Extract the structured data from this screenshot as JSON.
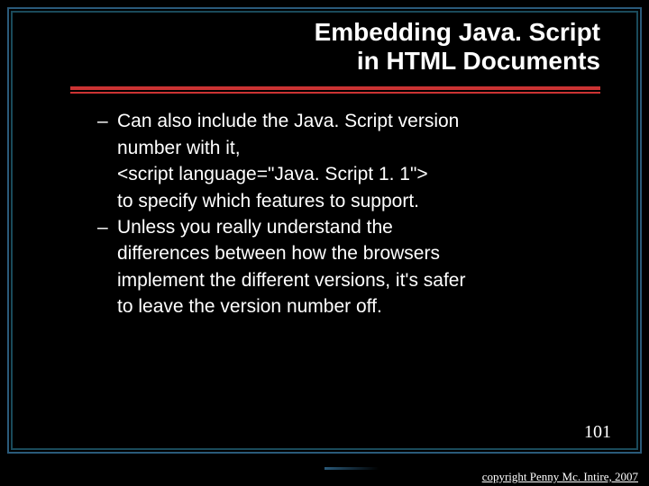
{
  "title": {
    "line1": "Embedding Java. Script",
    "line2": "in HTML Documents"
  },
  "bullets": [
    {
      "lines": [
        "Can also include the Java. Script version",
        "number with it,",
        "<script language=\"Java. Script 1. 1\">",
        "to specify which features to support."
      ]
    },
    {
      "lines": [
        "Unless you really understand the",
        "differences between how the browsers",
        "implement the different versions, it's safer",
        "to leave the version number off."
      ]
    }
  ],
  "page_number": "101",
  "copyright": "copyright Penny Mc. Intire, 2007"
}
